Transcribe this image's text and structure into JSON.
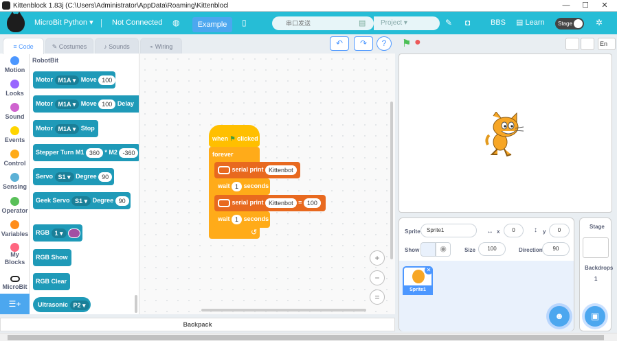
{
  "window": {
    "title": "Kittenblock 1.83j (C:\\Users\\Administrator\\AppData\\Roaming\\Kittenblocl",
    "minimize": "—",
    "maximize": "☐",
    "close": "✕"
  },
  "menubar": {
    "mode": "MicroBit Python",
    "connection": "Not Connected",
    "example": "Example",
    "serial_placeholder": "串口发送",
    "project": "Project",
    "bbs": "BBS",
    "learn": "Learn",
    "stage_toggle": "Stage",
    "icons": {
      "caret": "▾",
      "globe": "◍",
      "file": "▯",
      "save": "▤",
      "edit": "✎",
      "camera": "◘",
      "learn": "▤",
      "settings": "✲"
    }
  },
  "tabs": [
    {
      "label": "Code",
      "icon": "≡"
    },
    {
      "label": "Costumes",
      "icon": "✎"
    },
    {
      "label": "Sounds",
      "icon": "♪"
    },
    {
      "label": "Wiring",
      "icon": "⌁"
    }
  ],
  "controls": {
    "undo": "↶",
    "redo": "↷",
    "help": "?",
    "green_flag": "⚑",
    "stop": "●"
  },
  "categories": [
    {
      "label": "Motion",
      "color": "#4c97ff"
    },
    {
      "label": "Looks",
      "color": "#9966ff"
    },
    {
      "label": "Sound",
      "color": "#cf63cf"
    },
    {
      "label": "Events",
      "color": "#ffd500"
    },
    {
      "label": "Control",
      "color": "#ffab19"
    },
    {
      "label": "Sensing",
      "color": "#5cb1d6"
    },
    {
      "label": "Operator",
      "color": "#59c059"
    },
    {
      "label": "Variables",
      "color": "#ff8c1a"
    },
    {
      "label": "My Blocks",
      "color": "#ff6680"
    },
    {
      "label": "MicroBit",
      "color": "#222222"
    }
  ],
  "palette": {
    "heading": "RobotBit",
    "blocks": {
      "motor_move": {
        "label": "Motor",
        "port": "M1A",
        "move": "Move",
        "value": "100"
      },
      "motor_move_delay": {
        "label": "Motor",
        "port": "M1A",
        "move": "Move",
        "value": "100",
        "delay": "Delay"
      },
      "motor_stop": {
        "label": "Motor",
        "port": "M1A",
        "stop": "Stop"
      },
      "stepper": {
        "label": "Stepper Turn M1",
        "m1": "360",
        "m2_label": "* M2",
        "m2": "-360"
      },
      "servo": {
        "label": "Servo",
        "port": "S1",
        "degree_label": "Degree",
        "degree": "90"
      },
      "geek_servo": {
        "label": "Geek Servo",
        "port": "S1",
        "degree_label": "Degree",
        "degree": "90"
      },
      "rgb": {
        "label": "RGB",
        "index": "1",
        "color": "#a350a3"
      },
      "rgb_show": {
        "label": "RGB Show"
      },
      "rgb_clear": {
        "label": "RGB Clear"
      },
      "ultrasonic": {
        "label": "Ultrasonic",
        "port": "P2"
      }
    }
  },
  "script": {
    "hat": {
      "when": "when",
      "clicked": "clicked"
    },
    "forever": "forever",
    "print1": {
      "label": "serial print",
      "value": "Kittenbot"
    },
    "wait1": {
      "label": "wait",
      "value": "1",
      "unit": "seconds"
    },
    "print2": {
      "label": "serial print",
      "value": "Kittenbot",
      "eq": "=",
      "value2": "100"
    },
    "wait2": {
      "label": "wait",
      "value": "1",
      "unit": "seconds"
    },
    "loop_arrow": "↺"
  },
  "zoom": {
    "in": "+",
    "out": "−",
    "reset": "="
  },
  "backpack": "Backpack",
  "stage_header": {
    "lang": "En"
  },
  "sprite_info": {
    "sprite_label": "Sprite",
    "sprite_name": "Sprite1",
    "x_label": "x",
    "x": "0",
    "y_label": "y",
    "y": "0",
    "show_label": "Show",
    "size_label": "Size",
    "size": "100",
    "direction_label": "Direction",
    "direction": "90"
  },
  "sprites": [
    {
      "name": "Sprite1"
    }
  ],
  "stage_panel": {
    "title": "Stage",
    "backdrops_label": "Backdrops",
    "backdrops_count": "1"
  }
}
